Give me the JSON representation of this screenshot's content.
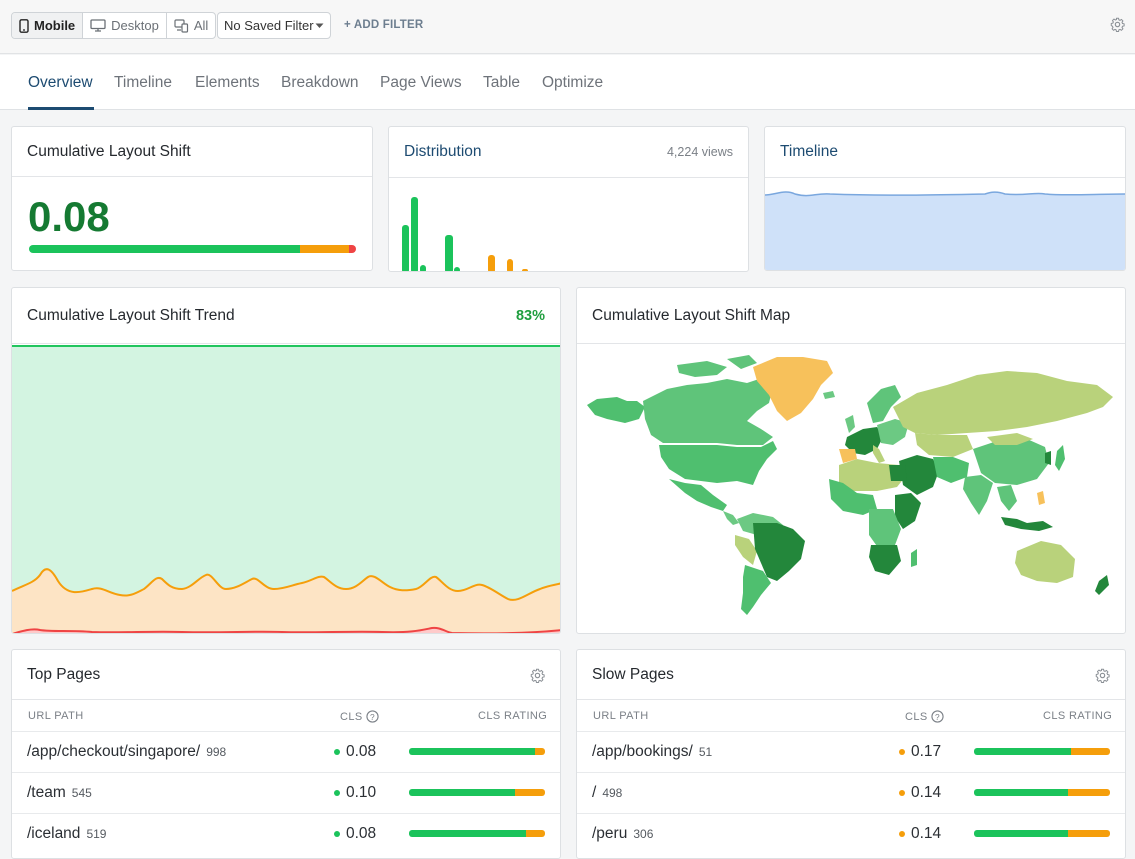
{
  "toolbar": {
    "devices": [
      {
        "label": "Mobile",
        "icon": "mobile-icon",
        "active": true
      },
      {
        "label": "Desktop",
        "icon": "desktop-icon",
        "active": false
      },
      {
        "label": "All",
        "icon": "devices-icon",
        "active": false
      }
    ],
    "saved_filter": "No Saved Filter",
    "add_filter": "+ ADD FILTER"
  },
  "tabs": [
    "Overview",
    "Timeline",
    "Elements",
    "Breakdown",
    "Page Views",
    "Table",
    "Optimize"
  ],
  "active_tab": "Overview",
  "cls_card": {
    "title": "Cumulative Layout Shift",
    "value": "0.08",
    "bar": {
      "good": 83,
      "needs": 15,
      "poor": 2
    }
  },
  "distribution": {
    "title": "Distribution",
    "views": "4,224 views"
  },
  "timeline": {
    "title": "Timeline"
  },
  "trend": {
    "title": "Cumulative Layout Shift Trend",
    "percent": "83%"
  },
  "map": {
    "title": "Cumulative Layout Shift Map"
  },
  "top_pages": {
    "title": "Top Pages",
    "headers": {
      "path": "URL PATH",
      "cls": "CLS",
      "rating": "CLS RATING"
    },
    "rows": [
      {
        "path": "/app/checkout/singapore/",
        "count": "998",
        "cls": "0.08",
        "status": "good",
        "good": 93,
        "needs": 7
      },
      {
        "path": "/team",
        "count": "545",
        "cls": "0.10",
        "status": "good",
        "good": 78,
        "needs": 22
      },
      {
        "path": "/iceland",
        "count": "519",
        "cls": "0.08",
        "status": "good",
        "good": 86,
        "needs": 14
      }
    ]
  },
  "slow_pages": {
    "title": "Slow Pages",
    "headers": {
      "path": "URL PATH",
      "cls": "CLS",
      "rating": "CLS RATING"
    },
    "rows": [
      {
        "path": "/app/bookings/",
        "count": "51",
        "cls": "0.17",
        "status": "needs",
        "good": 71,
        "needs": 29
      },
      {
        "path": "/",
        "count": "498",
        "cls": "0.14",
        "status": "needs",
        "good": 69,
        "needs": 31
      },
      {
        "path": "/peru",
        "count": "306",
        "cls": "0.14",
        "status": "needs",
        "good": 69,
        "needs": 31
      }
    ]
  },
  "colors": {
    "good": "#1bc35b",
    "needs": "#f59e0b",
    "poor": "#ef4444",
    "accent": "#1d4b71"
  }
}
